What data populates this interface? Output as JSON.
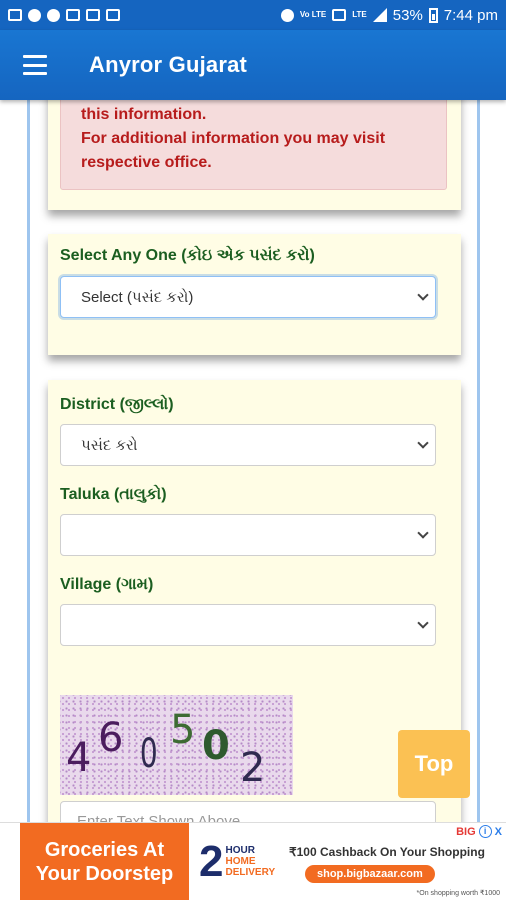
{
  "status_bar": {
    "battery": "53%",
    "time": "7:44 pm",
    "volte": "Vo LTE",
    "lte": "LTE"
  },
  "app_bar": {
    "title": "Anyror Gujarat"
  },
  "notice": {
    "line1": "this information.",
    "line2": "For additional information you may visit",
    "line3": "respective office."
  },
  "select_any": {
    "label": "Select Any One (કોઇ એક પસંદ કરો)",
    "value": "Select (પસંદ કરો)"
  },
  "district": {
    "label": "District (જીલ્લો)",
    "value": "પસંદ કરો"
  },
  "taluka": {
    "label": "Taluka (તાલુકો)",
    "value": ""
  },
  "village": {
    "label": "Village (ગામ)",
    "value": ""
  },
  "captcha": {
    "digits": [
      "4",
      "6",
      "0",
      "5",
      "0",
      "2"
    ],
    "input_placeholder": "Enter Text Shown Above"
  },
  "top_button": {
    "label": "Top"
  },
  "ad": {
    "headline_1": "Groceries At",
    "headline_2": "Your Doorstep",
    "big_number": "2",
    "hour": "HOUR",
    "home_delivery_1": "HOME",
    "home_delivery_2": "DELIVERY",
    "cashback": "₹100 Cashback On Your Shopping",
    "url": "shop.bigbazaar.com",
    "note": "*On shopping worth ₹1000",
    "brand": "BIG",
    "info": "i",
    "close": "X"
  },
  "colors": {
    "app_bar": "#1565c0",
    "card_bg": "#fffde5",
    "label_green": "#1b5e20",
    "alert_text": "#b71c1c",
    "top_button": "#fbc153",
    "ad_orange": "#f26b21"
  }
}
